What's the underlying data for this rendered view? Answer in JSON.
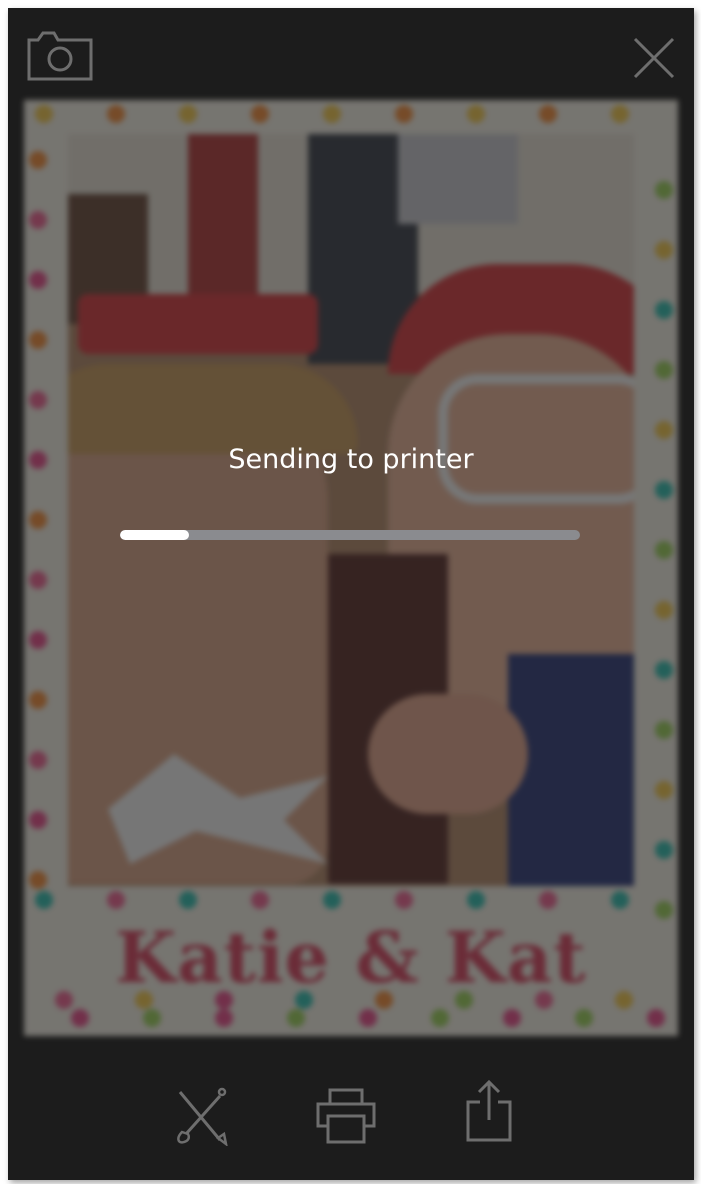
{
  "status": {
    "label": "Sending to printer",
    "progress_fraction": 0.15
  },
  "photo": {
    "caption": "Katie & Kat"
  },
  "icons": {
    "camera": "camera-icon",
    "close": "close-icon",
    "edit": "edit-brush-icon",
    "print": "printer-icon",
    "share": "share-icon"
  },
  "colors": {
    "background": "#1c1c1c",
    "icon": "#6e6e6e",
    "progress_track": "#8a8b8f",
    "progress_fill": "#ffffff",
    "caption": "#d8435f"
  }
}
